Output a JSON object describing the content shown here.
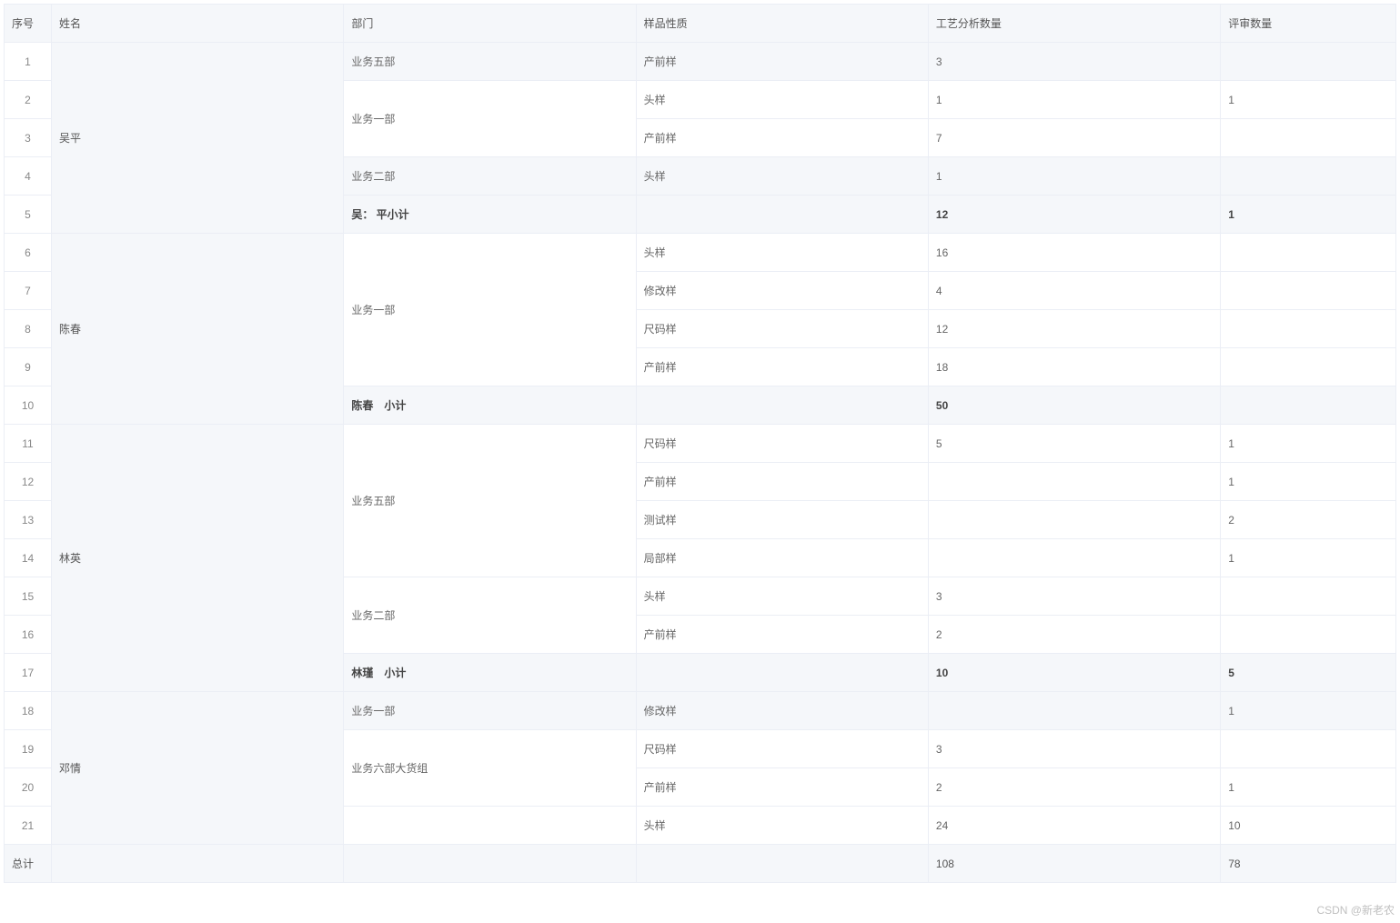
{
  "headers": {
    "seq": "序号",
    "name": "姓名",
    "dept": "部门",
    "nature": "样品性质",
    "qty1": "工艺分析数量",
    "qty2": "评审数量"
  },
  "groups": [
    {
      "name": "吴平",
      "rows": [
        {
          "seq": "1",
          "dept": "业务五部",
          "dept_span": 1,
          "nature": "产前样",
          "qty1": "3",
          "qty2": "",
          "shade": true
        },
        {
          "seq": "2",
          "dept": "业务一部",
          "dept_span": 2,
          "nature": "头样",
          "qty1": "1",
          "qty2": "1",
          "shade": false
        },
        {
          "seq": "3",
          "dept": "",
          "dept_span": 0,
          "nature": "产前样",
          "qty1": "7",
          "qty2": "",
          "shade": false
        },
        {
          "seq": "4",
          "dept": "业务二部",
          "dept_span": 1,
          "nature": "头样",
          "qty1": "1",
          "qty2": "",
          "shade": true
        }
      ],
      "subtotal": {
        "seq": "5",
        "label": "吴： 平小计",
        "qty1": "12",
        "qty2": "1"
      }
    },
    {
      "name": "陈春",
      "rows": [
        {
          "seq": "6",
          "dept": "业务一部",
          "dept_span": 4,
          "nature": "头样",
          "qty1": "16",
          "qty2": "",
          "shade": false
        },
        {
          "seq": "7",
          "dept": "",
          "dept_span": 0,
          "nature": "修改样",
          "qty1": "4",
          "qty2": "",
          "shade": false
        },
        {
          "seq": "8",
          "dept": "",
          "dept_span": 0,
          "nature": "尺码样",
          "qty1": "12",
          "qty2": "",
          "shade": false
        },
        {
          "seq": "9",
          "dept": "",
          "dept_span": 0,
          "nature": "产前样",
          "qty1": "18",
          "qty2": "",
          "shade": false
        }
      ],
      "subtotal": {
        "seq": "10",
        "label": "陈春　小计",
        "qty1": "50",
        "qty2": ""
      }
    },
    {
      "name": "林英",
      "rows": [
        {
          "seq": "11",
          "dept": "业务五部",
          "dept_span": 4,
          "nature": "尺码样",
          "qty1": "5",
          "qty2": "1",
          "shade": false
        },
        {
          "seq": "12",
          "dept": "",
          "dept_span": 0,
          "nature": "产前样",
          "qty1": "",
          "qty2": "1",
          "shade": false
        },
        {
          "seq": "13",
          "dept": "",
          "dept_span": 0,
          "nature": "测试样",
          "qty1": "",
          "qty2": "2",
          "shade": false
        },
        {
          "seq": "14",
          "dept": "",
          "dept_span": 0,
          "nature": "局部样",
          "qty1": "",
          "qty2": "1",
          "shade": false
        },
        {
          "seq": "15",
          "dept": "业务二部",
          "dept_span": 2,
          "nature": "头样",
          "qty1": "3",
          "qty2": "",
          "shade": false
        },
        {
          "seq": "16",
          "dept": "",
          "dept_span": 0,
          "nature": "产前样",
          "qty1": "2",
          "qty2": "",
          "shade": false
        }
      ],
      "subtotal": {
        "seq": "17",
        "label": "林瑾　小计",
        "qty1": "10",
        "qty2": "5"
      }
    },
    {
      "name": "邓情",
      "rows": [
        {
          "seq": "18",
          "dept": "业务一部",
          "dept_span": 1,
          "nature": "修改样",
          "qty1": "",
          "qty2": "1",
          "shade": true
        },
        {
          "seq": "19",
          "dept": "业务六部大货组",
          "dept_span": 2,
          "nature": "尺码样",
          "qty1": "3",
          "qty2": "",
          "shade": false
        },
        {
          "seq": "20",
          "dept": "",
          "dept_span": 0,
          "nature": "产前样",
          "qty1": "2",
          "qty2": "1",
          "shade": false
        },
        {
          "seq": "21",
          "dept": "",
          "dept_span": 1,
          "nature": "头样",
          "qty1": "24",
          "qty2": "10",
          "shade": false
        }
      ],
      "subtotal": null
    }
  ],
  "total": {
    "label": "总计",
    "qty1": "108",
    "qty2": "78"
  },
  "watermark": "CSDN @新老农"
}
